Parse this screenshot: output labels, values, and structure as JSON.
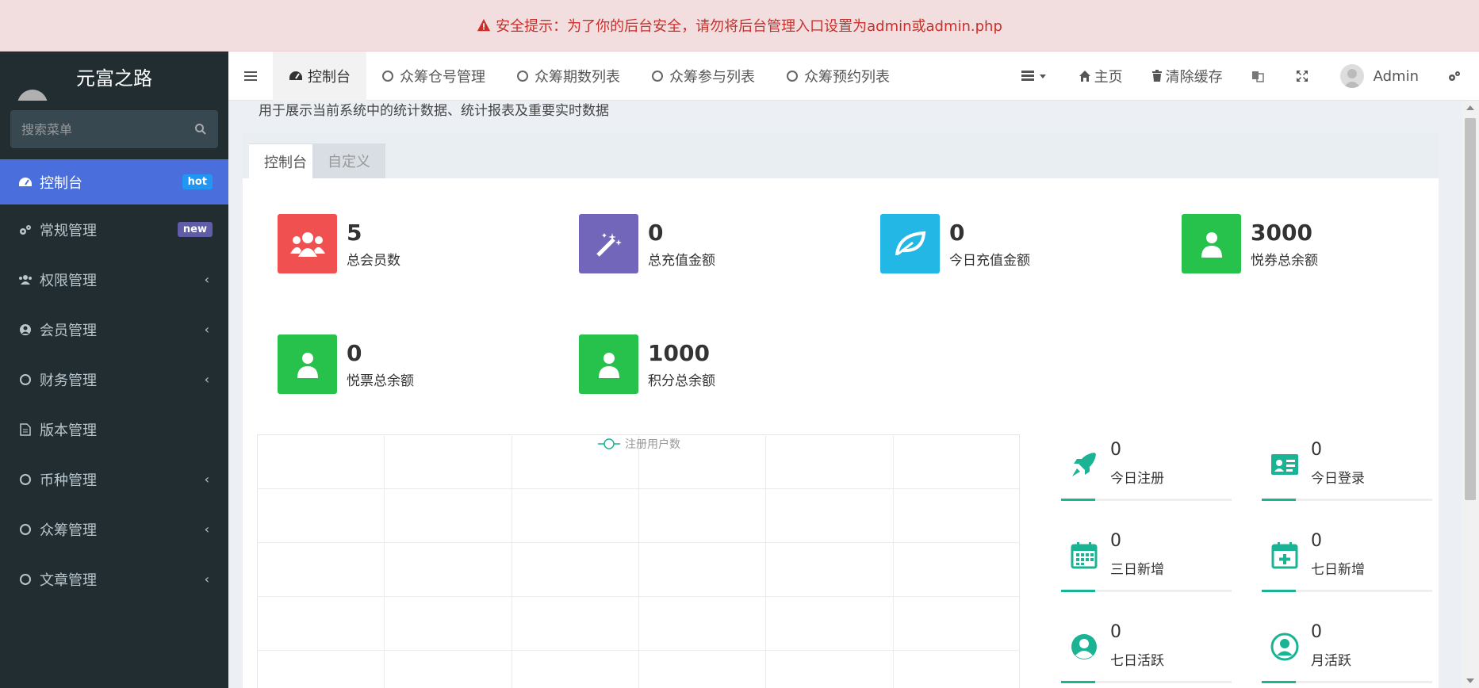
{
  "alert": {
    "text": "安全提示：为了你的后台安全，请勿将后台管理入口设置为admin或admin.php",
    "icon": "warning-icon"
  },
  "sidebar": {
    "logo": "元富之路",
    "search_placeholder": "搜索菜单",
    "items": [
      {
        "label": "控制台",
        "icon": "dashboard-icon",
        "badge": "hot",
        "active": true
      },
      {
        "label": "常规管理",
        "icon": "cogs-icon",
        "badge": "new"
      },
      {
        "label": "权限管理",
        "icon": "group-icon",
        "chevron": "‹"
      },
      {
        "label": "会员管理",
        "icon": "user-circle-icon",
        "chevron": "‹"
      },
      {
        "label": "财务管理",
        "icon": "circle-icon",
        "chevron": "‹"
      },
      {
        "label": "版本管理",
        "icon": "file-icon"
      },
      {
        "label": "币种管理",
        "icon": "circle-icon",
        "chevron": "‹"
      },
      {
        "label": "众筹管理",
        "icon": "circle-icon",
        "chevron": "‹"
      },
      {
        "label": "文章管理",
        "icon": "circle-icon",
        "chevron": "‹"
      }
    ]
  },
  "navbar": {
    "tabs": [
      {
        "label": "控制台",
        "icon": "dashboard-icon",
        "active": true
      },
      {
        "label": "众筹仓号管理",
        "icon": "circle-icon"
      },
      {
        "label": "众筹期数列表",
        "icon": "circle-icon"
      },
      {
        "label": "众筹参与列表",
        "icon": "circle-icon"
      },
      {
        "label": "众筹预约列表",
        "icon": "circle-icon"
      }
    ],
    "home": "主页",
    "clear_cache": "清除缓存",
    "user": "Admin"
  },
  "page": {
    "subtitle": "用于展示当前系统中的统计数据、统计报表及重要实时数据",
    "tabs": [
      "控制台",
      "自定义"
    ]
  },
  "stats": [
    {
      "value": "5",
      "label": "总会员数",
      "icon": "users-icon",
      "color": "#f05050"
    },
    {
      "value": "0",
      "label": "总充值金额",
      "icon": "magic-icon",
      "color": "#7266ba"
    },
    {
      "value": "0",
      "label": "今日充值金额",
      "icon": "leaf-icon",
      "color": "#23b7e5"
    },
    {
      "value": "3000",
      "label": "悦券总余额",
      "icon": "user-icon",
      "color": "#27c24c"
    },
    {
      "value": "0",
      "label": "悦票总余额",
      "icon": "user-icon",
      "color": "#27c24c"
    },
    {
      "value": "1000",
      "label": "积分总余额",
      "icon": "user-icon",
      "color": "#27c24c"
    }
  ],
  "chart_data": {
    "type": "line",
    "series": [
      {
        "name": "注册用户数",
        "values": []
      }
    ],
    "categories": [],
    "grid": true
  },
  "mini_stats": [
    {
      "value": "0",
      "label": "今日注册",
      "icon": "rocket-icon"
    },
    {
      "value": "0",
      "label": "今日登录",
      "icon": "id-card-icon"
    },
    {
      "value": "0",
      "label": "三日新增",
      "icon": "calendar-icon"
    },
    {
      "value": "0",
      "label": "七日新增",
      "icon": "calendar-plus-icon"
    },
    {
      "value": "0",
      "label": "七日活跃",
      "icon": "user-circle-icon"
    },
    {
      "value": "0",
      "label": "月活跃",
      "icon": "user-circle-icon"
    }
  ],
  "colors": {
    "accent": "#4a6fdc",
    "teal": "#1ab394",
    "sidebar": "#222d32"
  }
}
